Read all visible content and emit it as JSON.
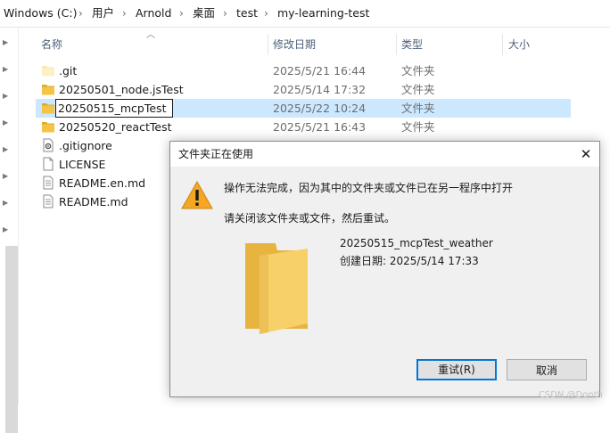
{
  "breadcrumb": {
    "items": [
      "Windows (C:)",
      "用户",
      "Arnold",
      "桌面",
      "test",
      "my-learning-test"
    ],
    "separator": "›"
  },
  "columns": {
    "name": "名称",
    "date": "修改日期",
    "type": "类型",
    "size": "大小"
  },
  "files": [
    {
      "name": ".git",
      "date": "2025/5/21 16:44",
      "type": "文件夹",
      "icon": "folder-light-icon"
    },
    {
      "name": "20250501_node.jsTest",
      "date": "2025/5/14 17:32",
      "type": "文件夹",
      "icon": "folder-icon"
    },
    {
      "name": "20250515_mcpTest",
      "date": "2025/5/22 10:24",
      "type": "文件夹",
      "icon": "folder-icon",
      "selected": true,
      "renaming": true
    },
    {
      "name": "20250520_reactTest",
      "date": "2025/5/21 16:43",
      "type": "文件夹",
      "icon": "folder-icon"
    },
    {
      "name": ".gitignore",
      "icon": "gear-file-icon"
    },
    {
      "name": "LICENSE",
      "icon": "blank-file-icon"
    },
    {
      "name": "README.en.md",
      "icon": "text-file-icon"
    },
    {
      "name": "README.md",
      "icon": "text-file-icon"
    }
  ],
  "dialog": {
    "title": "文件夹正在使用",
    "message": "操作无法完成，因为其中的文件夹或文件已在另一程序中打开",
    "instruction": "请关闭该文件夹或文件，然后重试。",
    "item_name": "20250515_mcpTest_weather",
    "item_created": "创建日期: 2025/5/14 17:33",
    "retry_label": "重试(R)",
    "cancel_label": "取消",
    "close_glyph": "✕"
  },
  "watermark": "CSDN @Donth",
  "colors": {
    "selection": "#cce8ff",
    "folder": "#f5c445",
    "folder_dark": "#e0a82e",
    "warning": "#f5a623",
    "accent_border": "#0078d7"
  }
}
